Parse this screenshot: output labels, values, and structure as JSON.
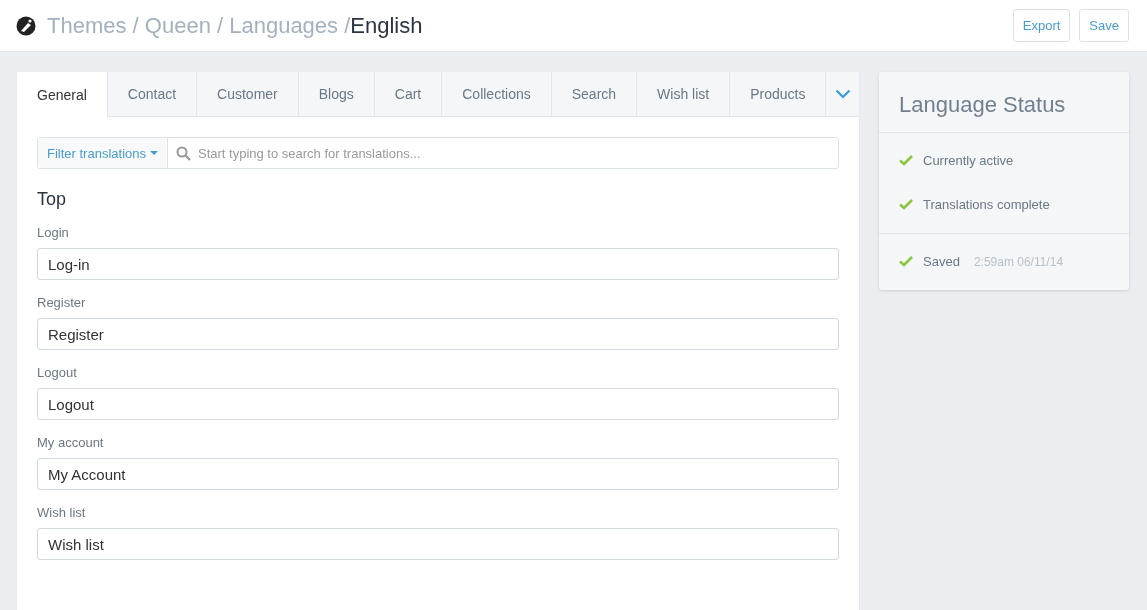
{
  "header": {
    "trail": "Themes / Queen / Languages /",
    "current": "English",
    "buttons": [
      "Export",
      "Save"
    ]
  },
  "tabs": [
    {
      "label": "General",
      "selected": true
    },
    {
      "label": "Contact",
      "selected": false
    },
    {
      "label": "Customer",
      "selected": false
    },
    {
      "label": "Blogs",
      "selected": false
    },
    {
      "label": "Cart",
      "selected": false
    },
    {
      "label": "Collections",
      "selected": false
    },
    {
      "label": "Search",
      "selected": false
    },
    {
      "label": "Wish list",
      "selected": false
    },
    {
      "label": "Products",
      "selected": false
    }
  ],
  "filter": {
    "label": "Filter translations",
    "placeholder": "Start typing to search for translations..."
  },
  "section": "Top",
  "fields": [
    {
      "label": "Login",
      "value": "Log-in"
    },
    {
      "label": "Register",
      "value": "Register"
    },
    {
      "label": "Logout",
      "value": "Logout"
    },
    {
      "label": "My account",
      "value": "My Account"
    },
    {
      "label": "Wish list",
      "value": "Wish list"
    }
  ],
  "status": {
    "title": "Language Status",
    "items": [
      {
        "text": "Currently active",
        "checked": true
      },
      {
        "text": "Translations complete",
        "checked": true
      },
      {
        "text": "Saved",
        "time": "2:59am 06/11/14",
        "checked": true
      }
    ]
  }
}
